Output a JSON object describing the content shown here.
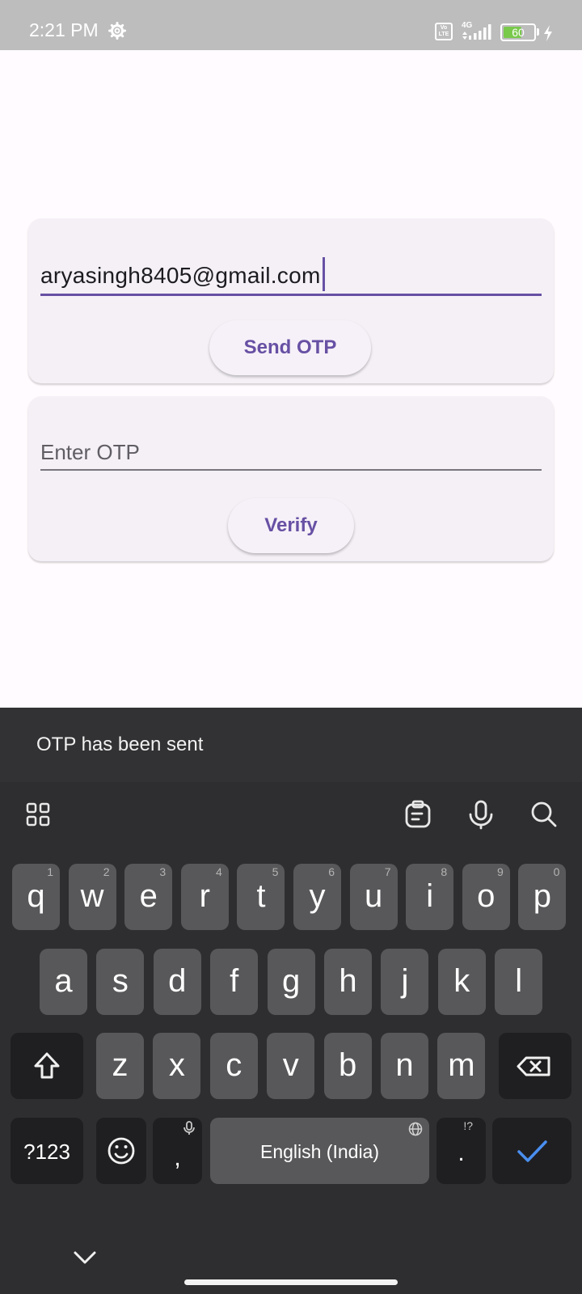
{
  "status_bar": {
    "time": "2:21 PM",
    "network": "4G",
    "volte": "Vo LTE",
    "battery": "60",
    "battery_level": 0.6
  },
  "email_card": {
    "email_value": "aryasingh8405@gmail.com",
    "send_button": "Send OTP"
  },
  "otp_card": {
    "otp_placeholder": "Enter OTP",
    "verify_button": "Verify"
  },
  "snackbar": {
    "message": "OTP has been sent"
  },
  "keyboard": {
    "row1": [
      {
        "letter": "q",
        "hint": "1"
      },
      {
        "letter": "w",
        "hint": "2"
      },
      {
        "letter": "e",
        "hint": "3"
      },
      {
        "letter": "r",
        "hint": "4"
      },
      {
        "letter": "t",
        "hint": "5"
      },
      {
        "letter": "y",
        "hint": "6"
      },
      {
        "letter": "u",
        "hint": "7"
      },
      {
        "letter": "i",
        "hint": "8"
      },
      {
        "letter": "o",
        "hint": "9"
      },
      {
        "letter": "p",
        "hint": "0"
      }
    ],
    "row2": [
      "a",
      "s",
      "d",
      "f",
      "g",
      "h",
      "j",
      "k",
      "l"
    ],
    "row3": [
      "z",
      "x",
      "c",
      "v",
      "b",
      "n",
      "m"
    ],
    "symbols_key": "?123",
    "comma_key": ",",
    "space_key": "English (India)",
    "period_key": ".",
    "period_hint": "!?",
    "accent_color": "#4a8ff0"
  },
  "colors": {
    "primary": "#6750a4",
    "background": "#fffbfe",
    "card": "#f4f0f6",
    "snackbar": "#323234",
    "keyboard": "#2e2e30"
  }
}
